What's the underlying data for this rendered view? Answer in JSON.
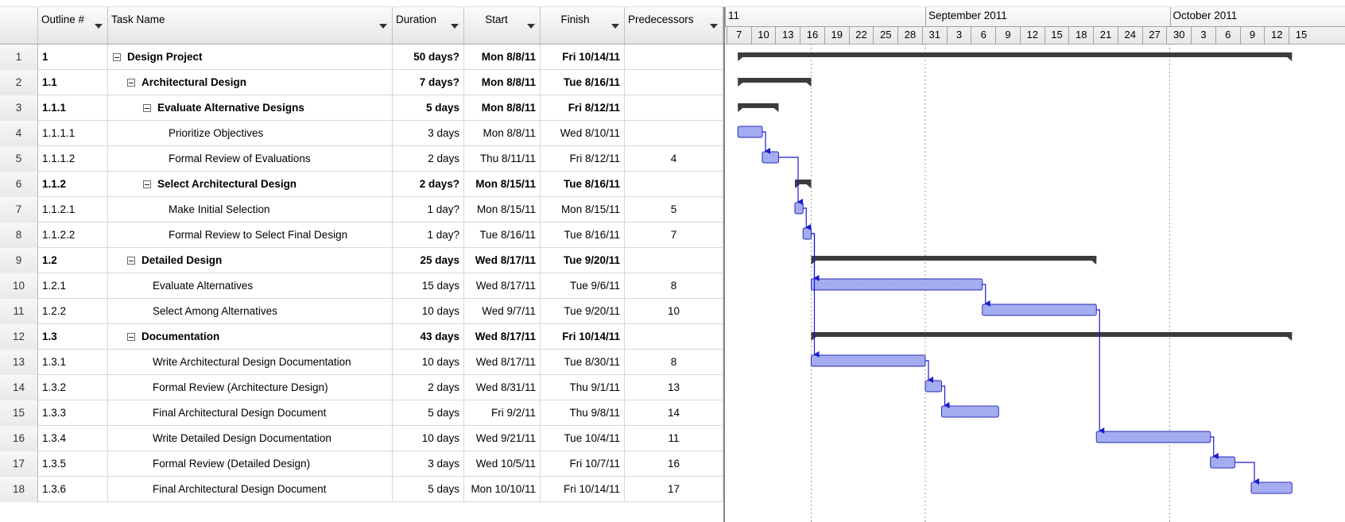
{
  "table": {
    "headers": {
      "outline": "Outline #",
      "name": "Task Name",
      "duration": "Duration",
      "start": "Start",
      "finish": "Finish",
      "predecessors": "Predecessors"
    },
    "rows": [
      {
        "id": "1",
        "outline": "1",
        "name": "Design Project",
        "duration": "50 days?",
        "start": "Mon 8/8/11",
        "finish": "Fri 10/14/11",
        "pred": "",
        "summary": true,
        "level": 0
      },
      {
        "id": "2",
        "outline": "1.1",
        "name": "Architectural Design",
        "duration": "7 days?",
        "start": "Mon 8/8/11",
        "finish": "Tue 8/16/11",
        "pred": "",
        "summary": true,
        "level": 1
      },
      {
        "id": "3",
        "outline": "1.1.1",
        "name": "Evaluate Alternative Designs",
        "duration": "5 days",
        "start": "Mon 8/8/11",
        "finish": "Fri 8/12/11",
        "pred": "",
        "summary": true,
        "level": 2
      },
      {
        "id": "4",
        "outline": "1.1.1.1",
        "name": "Prioritize Objectives",
        "duration": "3 days",
        "start": "Mon 8/8/11",
        "finish": "Wed 8/10/11",
        "pred": "",
        "summary": false,
        "level": 3
      },
      {
        "id": "5",
        "outline": "1.1.1.2",
        "name": "Formal Review of Evaluations",
        "duration": "2 days",
        "start": "Thu 8/11/11",
        "finish": "Fri 8/12/11",
        "pred": "4",
        "summary": false,
        "level": 3
      },
      {
        "id": "6",
        "outline": "1.1.2",
        "name": "Select Architectural Design",
        "duration": "2 days?",
        "start": "Mon 8/15/11",
        "finish": "Tue 8/16/11",
        "pred": "",
        "summary": true,
        "level": 2
      },
      {
        "id": "7",
        "outline": "1.1.2.1",
        "name": "Make Initial Selection",
        "duration": "1 day?",
        "start": "Mon 8/15/11",
        "finish": "Mon 8/15/11",
        "pred": "5",
        "summary": false,
        "level": 3
      },
      {
        "id": "8",
        "outline": "1.1.2.2",
        "name": "Formal Review to Select Final Design",
        "duration": "1 day?",
        "start": "Tue 8/16/11",
        "finish": "Tue 8/16/11",
        "pred": "7",
        "summary": false,
        "level": 3
      },
      {
        "id": "9",
        "outline": "1.2",
        "name": "Detailed Design",
        "duration": "25 days",
        "start": "Wed 8/17/11",
        "finish": "Tue 9/20/11",
        "pred": "",
        "summary": true,
        "level": 1
      },
      {
        "id": "10",
        "outline": "1.2.1",
        "name": "Evaluate Alternatives",
        "duration": "15 days",
        "start": "Wed 8/17/11",
        "finish": "Tue 9/6/11",
        "pred": "8",
        "summary": false,
        "level": 2
      },
      {
        "id": "11",
        "outline": "1.2.2",
        "name": "Select Among Alternatives",
        "duration": "10 days",
        "start": "Wed 9/7/11",
        "finish": "Tue 9/20/11",
        "pred": "10",
        "summary": false,
        "level": 2
      },
      {
        "id": "12",
        "outline": "1.3",
        "name": "Documentation",
        "duration": "43 days",
        "start": "Wed 8/17/11",
        "finish": "Fri 10/14/11",
        "pred": "",
        "summary": true,
        "level": 1
      },
      {
        "id": "13",
        "outline": "1.3.1",
        "name": "Write Architectural Design Documentation",
        "duration": "10 days",
        "start": "Wed 8/17/11",
        "finish": "Tue 8/30/11",
        "pred": "8",
        "summary": false,
        "level": 2
      },
      {
        "id": "14",
        "outline": "1.3.2",
        "name": "Formal Review (Architecture Design)",
        "duration": "2 days",
        "start": "Wed 8/31/11",
        "finish": "Thu 9/1/11",
        "pred": "13",
        "summary": false,
        "level": 2
      },
      {
        "id": "15",
        "outline": "1.3.3",
        "name": "Final Architectural Design Document",
        "duration": "5 days",
        "start": "Fri 9/2/11",
        "finish": "Thu 9/8/11",
        "pred": "14",
        "summary": false,
        "level": 2
      },
      {
        "id": "16",
        "outline": "1.3.4",
        "name": "Write Detailed Design Documentation",
        "duration": "10 days",
        "start": "Wed 9/21/11",
        "finish": "Tue 10/4/11",
        "pred": "11",
        "summary": false,
        "level": 2
      },
      {
        "id": "17",
        "outline": "1.3.5",
        "name": "Formal Review (Detailed Design)",
        "duration": "3 days",
        "start": "Wed 10/5/11",
        "finish": "Fri 10/7/11",
        "pred": "16",
        "summary": false,
        "level": 2
      },
      {
        "id": "18",
        "outline": "1.3.6",
        "name": "Final Architectural Design Document",
        "duration": "5 days",
        "start": "Mon 10/10/11",
        "finish": "Fri 10/14/11",
        "pred": "17",
        "summary": false,
        "level": 2
      }
    ]
  },
  "gantt": {
    "months": [
      {
        "label": "11",
        "first_day": "2011-08-07"
      },
      {
        "label": "September 2011",
        "first_day": "2011-08-31"
      },
      {
        "label": "October 2011",
        "first_day": "2011-09-30"
      }
    ],
    "ticks": [
      {
        "label": "7",
        "date": "2011-08-07"
      },
      {
        "label": "10",
        "date": "2011-08-10"
      },
      {
        "label": "13",
        "date": "2011-08-13"
      },
      {
        "label": "16",
        "date": "2011-08-16"
      },
      {
        "label": "19",
        "date": "2011-08-19"
      },
      {
        "label": "22",
        "date": "2011-08-22"
      },
      {
        "label": "25",
        "date": "2011-08-25"
      },
      {
        "label": "28",
        "date": "2011-08-28"
      },
      {
        "label": "31",
        "date": "2011-08-31"
      },
      {
        "label": "3",
        "date": "2011-09-03"
      },
      {
        "label": "6",
        "date": "2011-09-06"
      },
      {
        "label": "9",
        "date": "2011-09-09"
      },
      {
        "label": "12",
        "date": "2011-09-12"
      },
      {
        "label": "15",
        "date": "2011-09-15"
      },
      {
        "label": "18",
        "date": "2011-09-18"
      },
      {
        "label": "21",
        "date": "2011-09-21"
      },
      {
        "label": "24",
        "date": "2011-09-24"
      },
      {
        "label": "27",
        "date": "2011-09-27"
      },
      {
        "label": "30",
        "date": "2011-09-30"
      },
      {
        "label": "3",
        "date": "2011-10-03"
      },
      {
        "label": "6",
        "date": "2011-10-06"
      },
      {
        "label": "9",
        "date": "2011-10-09"
      },
      {
        "label": "12",
        "date": "2011-10-12"
      },
      {
        "label": "15",
        "date": "2011-10-15"
      }
    ],
    "bars": [
      {
        "row": 1,
        "start": "2011-08-08",
        "end": "2011-10-14",
        "summary": true
      },
      {
        "row": 2,
        "start": "2011-08-08",
        "end": "2011-08-16",
        "summary": true
      },
      {
        "row": 3,
        "start": "2011-08-08",
        "end": "2011-08-12",
        "summary": true
      },
      {
        "row": 4,
        "start": "2011-08-08",
        "end": "2011-08-10",
        "summary": false
      },
      {
        "row": 5,
        "start": "2011-08-11",
        "end": "2011-08-12",
        "summary": false
      },
      {
        "row": 6,
        "start": "2011-08-15",
        "end": "2011-08-16",
        "summary": true
      },
      {
        "row": 7,
        "start": "2011-08-15",
        "end": "2011-08-15",
        "summary": false
      },
      {
        "row": 8,
        "start": "2011-08-16",
        "end": "2011-08-16",
        "summary": false
      },
      {
        "row": 9,
        "start": "2011-08-17",
        "end": "2011-09-20",
        "summary": true
      },
      {
        "row": 10,
        "start": "2011-08-17",
        "end": "2011-09-06",
        "summary": false
      },
      {
        "row": 11,
        "start": "2011-09-07",
        "end": "2011-09-20",
        "summary": false
      },
      {
        "row": 12,
        "start": "2011-08-17",
        "end": "2011-10-14",
        "summary": true
      },
      {
        "row": 13,
        "start": "2011-08-17",
        "end": "2011-08-30",
        "summary": false
      },
      {
        "row": 14,
        "start": "2011-08-31",
        "end": "2011-09-01",
        "summary": false
      },
      {
        "row": 15,
        "start": "2011-09-02",
        "end": "2011-09-08",
        "summary": false
      },
      {
        "row": 16,
        "start": "2011-09-21",
        "end": "2011-10-04",
        "summary": false
      },
      {
        "row": 17,
        "start": "2011-10-05",
        "end": "2011-10-07",
        "summary": false
      },
      {
        "row": 18,
        "start": "2011-10-10",
        "end": "2011-10-14",
        "summary": false
      }
    ],
    "links": [
      [
        4,
        5
      ],
      [
        5,
        7
      ],
      [
        7,
        8
      ],
      [
        8,
        10
      ],
      [
        10,
        11
      ],
      [
        8,
        13
      ],
      [
        13,
        14
      ],
      [
        14,
        15
      ],
      [
        11,
        16
      ],
      [
        16,
        17
      ],
      [
        17,
        18
      ]
    ],
    "colors": {
      "task_fill": "#9fa8f0",
      "task_border": "#2b2bb5",
      "summary": "#3c3c3c",
      "link": "#1a1ad0",
      "gridline": "#9a9a9a"
    }
  }
}
